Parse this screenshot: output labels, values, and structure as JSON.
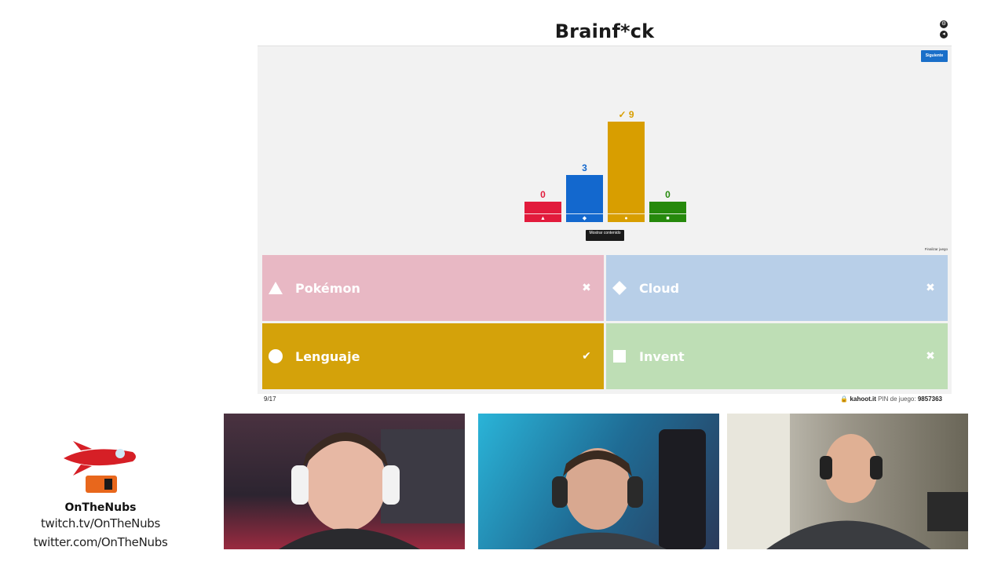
{
  "kahoot": {
    "title": "Brainf*ck",
    "next_button": "Siguiente",
    "show_content_button": "Mostrar contenido",
    "end_game_link": "Finalizar juego",
    "question_counter": "9/17",
    "domain": "kahoot.it",
    "pin_label": "PIN de juego:",
    "pin": "9857363",
    "top_icons": [
      "settings-icon",
      "exit-icon"
    ]
  },
  "chart_data": {
    "type": "bar",
    "categories": [
      "triangle",
      "diamond",
      "circle",
      "square"
    ],
    "values": [
      0,
      3,
      9,
      0
    ],
    "value_labels": [
      "0",
      "3",
      "✓ 9",
      "0"
    ],
    "colors": [
      "#e21b3c",
      "#1368ce",
      "#d89e00",
      "#26890c"
    ],
    "correct_index": 2
  },
  "answers": [
    {
      "label": "Pokémon",
      "shape": "triangle-icon",
      "color": "#e8b8c4",
      "correct": false,
      "mark": "✖"
    },
    {
      "label": "Cloud",
      "shape": "diamond-icon",
      "color": "#b8cfe8",
      "correct": false,
      "mark": "✖"
    },
    {
      "label": "Lenguaje",
      "shape": "circle-icon",
      "color": "#d4a20a",
      "correct": true,
      "mark": "✔"
    },
    {
      "label": "Invent",
      "shape": "square-icon",
      "color": "#bedeb5",
      "correct": false,
      "mark": "✖"
    }
  ],
  "branding": {
    "name": "OnTheNubs",
    "twitch": "twitch.tv/OnTheNubs",
    "twitter": "twitter.com/OnTheNubs",
    "logo": "rocket-icon"
  },
  "webcams": [
    {
      "name": "webcam-1",
      "bg": "#3a2c36"
    },
    {
      "name": "webcam-2",
      "bg": "#1f6c95"
    },
    {
      "name": "webcam-3",
      "bg": "#9a9588"
    }
  ]
}
